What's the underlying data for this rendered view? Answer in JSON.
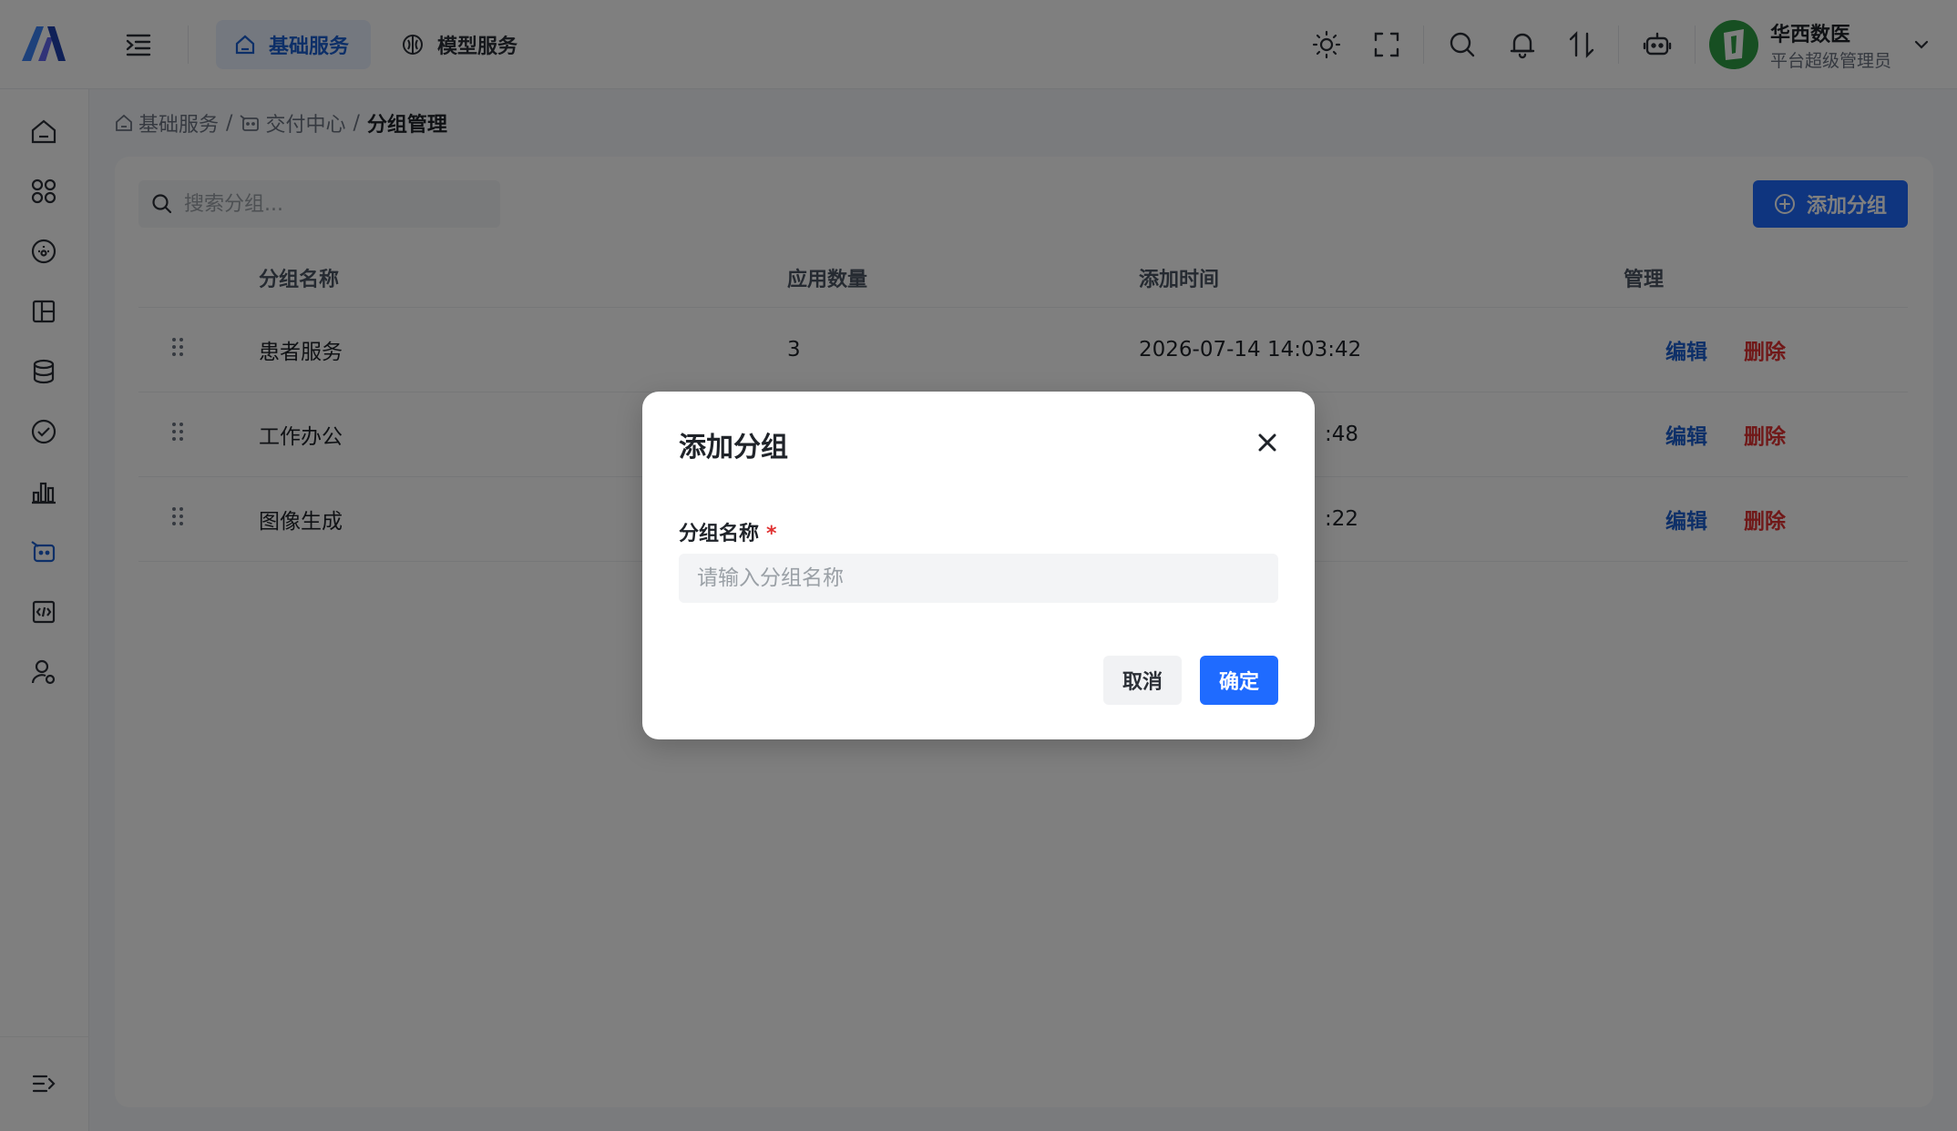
{
  "header": {
    "tabs": [
      {
        "label": "基础服务",
        "icon": "home-icon",
        "active": true
      },
      {
        "label": "模型服务",
        "icon": "brain-icon",
        "active": false
      }
    ],
    "icons": [
      "sun-icon",
      "fullscreen-icon",
      "search-icon",
      "bell-icon",
      "sort-icon",
      "robot-icon"
    ],
    "user": {
      "name": "华西数医",
      "role": "平台超级管理员"
    }
  },
  "sidebar": {
    "items": [
      "home-icon",
      "apps-icon",
      "dashboard-icon",
      "layout-icon",
      "database-icon",
      "check-circle-icon",
      "bar-chart-icon",
      "delivery-icon",
      "code-icon",
      "user-settings-icon"
    ],
    "active_index": 7
  },
  "breadcrumb": {
    "items": [
      "基础服务",
      "交付中心"
    ],
    "current": "分组管理",
    "separator": "/"
  },
  "toolbar": {
    "search_placeholder": "搜索分组...",
    "add_label": "添加分组"
  },
  "table": {
    "headers": {
      "name": "分组名称",
      "count": "应用数量",
      "time": "添加时间",
      "manage": "管理"
    },
    "rows": [
      {
        "name": "患者服务",
        "count": "3",
        "time": "2026-07-14 14:03:42",
        "edit": "编辑",
        "delete": "删除"
      },
      {
        "name": "工作办公",
        "count": "",
        "time": ":48",
        "edit": "编辑",
        "delete": "删除"
      },
      {
        "name": "图像生成",
        "count": "",
        "time": ":22",
        "edit": "编辑",
        "delete": "删除"
      }
    ]
  },
  "modal": {
    "title": "添加分组",
    "field_label": "分组名称",
    "required_mark": "*",
    "field_placeholder": "请输入分组名称",
    "field_value": "",
    "cancel_label": "取消",
    "ok_label": "确定"
  },
  "colors": {
    "primary": "#1f6bff",
    "danger": "#e03131",
    "link": "#1a5fd0"
  }
}
